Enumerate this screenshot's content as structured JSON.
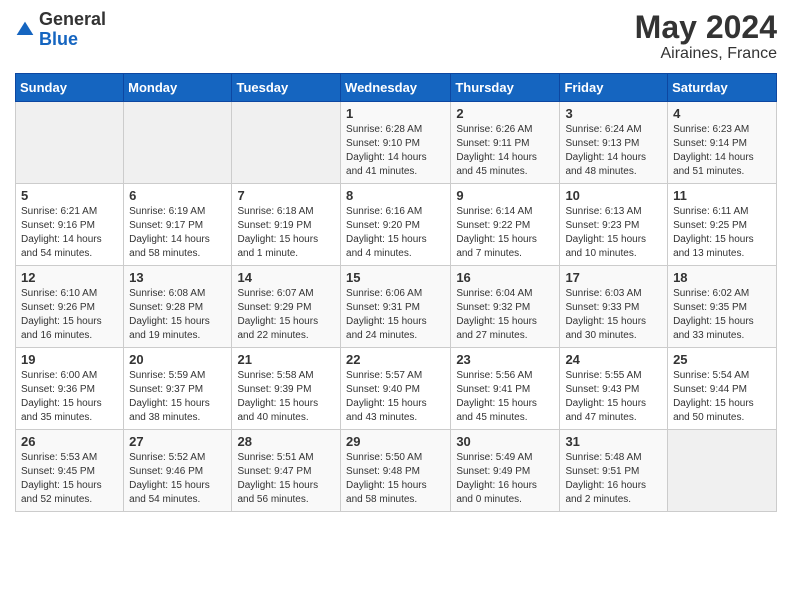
{
  "header": {
    "logo_line1": "General",
    "logo_line2": "Blue",
    "month_year": "May 2024",
    "location": "Airaines, France"
  },
  "weekdays": [
    "Sunday",
    "Monday",
    "Tuesday",
    "Wednesday",
    "Thursday",
    "Friday",
    "Saturday"
  ],
  "weeks": [
    [
      {
        "day": "",
        "info": ""
      },
      {
        "day": "",
        "info": ""
      },
      {
        "day": "",
        "info": ""
      },
      {
        "day": "1",
        "info": "Sunrise: 6:28 AM\nSunset: 9:10 PM\nDaylight: 14 hours\nand 41 minutes."
      },
      {
        "day": "2",
        "info": "Sunrise: 6:26 AM\nSunset: 9:11 PM\nDaylight: 14 hours\nand 45 minutes."
      },
      {
        "day": "3",
        "info": "Sunrise: 6:24 AM\nSunset: 9:13 PM\nDaylight: 14 hours\nand 48 minutes."
      },
      {
        "day": "4",
        "info": "Sunrise: 6:23 AM\nSunset: 9:14 PM\nDaylight: 14 hours\nand 51 minutes."
      }
    ],
    [
      {
        "day": "5",
        "info": "Sunrise: 6:21 AM\nSunset: 9:16 PM\nDaylight: 14 hours\nand 54 minutes."
      },
      {
        "day": "6",
        "info": "Sunrise: 6:19 AM\nSunset: 9:17 PM\nDaylight: 14 hours\nand 58 minutes."
      },
      {
        "day": "7",
        "info": "Sunrise: 6:18 AM\nSunset: 9:19 PM\nDaylight: 15 hours\nand 1 minute."
      },
      {
        "day": "8",
        "info": "Sunrise: 6:16 AM\nSunset: 9:20 PM\nDaylight: 15 hours\nand 4 minutes."
      },
      {
        "day": "9",
        "info": "Sunrise: 6:14 AM\nSunset: 9:22 PM\nDaylight: 15 hours\nand 7 minutes."
      },
      {
        "day": "10",
        "info": "Sunrise: 6:13 AM\nSunset: 9:23 PM\nDaylight: 15 hours\nand 10 minutes."
      },
      {
        "day": "11",
        "info": "Sunrise: 6:11 AM\nSunset: 9:25 PM\nDaylight: 15 hours\nand 13 minutes."
      }
    ],
    [
      {
        "day": "12",
        "info": "Sunrise: 6:10 AM\nSunset: 9:26 PM\nDaylight: 15 hours\nand 16 minutes."
      },
      {
        "day": "13",
        "info": "Sunrise: 6:08 AM\nSunset: 9:28 PM\nDaylight: 15 hours\nand 19 minutes."
      },
      {
        "day": "14",
        "info": "Sunrise: 6:07 AM\nSunset: 9:29 PM\nDaylight: 15 hours\nand 22 minutes."
      },
      {
        "day": "15",
        "info": "Sunrise: 6:06 AM\nSunset: 9:31 PM\nDaylight: 15 hours\nand 24 minutes."
      },
      {
        "day": "16",
        "info": "Sunrise: 6:04 AM\nSunset: 9:32 PM\nDaylight: 15 hours\nand 27 minutes."
      },
      {
        "day": "17",
        "info": "Sunrise: 6:03 AM\nSunset: 9:33 PM\nDaylight: 15 hours\nand 30 minutes."
      },
      {
        "day": "18",
        "info": "Sunrise: 6:02 AM\nSunset: 9:35 PM\nDaylight: 15 hours\nand 33 minutes."
      }
    ],
    [
      {
        "day": "19",
        "info": "Sunrise: 6:00 AM\nSunset: 9:36 PM\nDaylight: 15 hours\nand 35 minutes."
      },
      {
        "day": "20",
        "info": "Sunrise: 5:59 AM\nSunset: 9:37 PM\nDaylight: 15 hours\nand 38 minutes."
      },
      {
        "day": "21",
        "info": "Sunrise: 5:58 AM\nSunset: 9:39 PM\nDaylight: 15 hours\nand 40 minutes."
      },
      {
        "day": "22",
        "info": "Sunrise: 5:57 AM\nSunset: 9:40 PM\nDaylight: 15 hours\nand 43 minutes."
      },
      {
        "day": "23",
        "info": "Sunrise: 5:56 AM\nSunset: 9:41 PM\nDaylight: 15 hours\nand 45 minutes."
      },
      {
        "day": "24",
        "info": "Sunrise: 5:55 AM\nSunset: 9:43 PM\nDaylight: 15 hours\nand 47 minutes."
      },
      {
        "day": "25",
        "info": "Sunrise: 5:54 AM\nSunset: 9:44 PM\nDaylight: 15 hours\nand 50 minutes."
      }
    ],
    [
      {
        "day": "26",
        "info": "Sunrise: 5:53 AM\nSunset: 9:45 PM\nDaylight: 15 hours\nand 52 minutes."
      },
      {
        "day": "27",
        "info": "Sunrise: 5:52 AM\nSunset: 9:46 PM\nDaylight: 15 hours\nand 54 minutes."
      },
      {
        "day": "28",
        "info": "Sunrise: 5:51 AM\nSunset: 9:47 PM\nDaylight: 15 hours\nand 56 minutes."
      },
      {
        "day": "29",
        "info": "Sunrise: 5:50 AM\nSunset: 9:48 PM\nDaylight: 15 hours\nand 58 minutes."
      },
      {
        "day": "30",
        "info": "Sunrise: 5:49 AM\nSunset: 9:49 PM\nDaylight: 16 hours\nand 0 minutes."
      },
      {
        "day": "31",
        "info": "Sunrise: 5:48 AM\nSunset: 9:51 PM\nDaylight: 16 hours\nand 2 minutes."
      },
      {
        "day": "",
        "info": ""
      }
    ]
  ]
}
